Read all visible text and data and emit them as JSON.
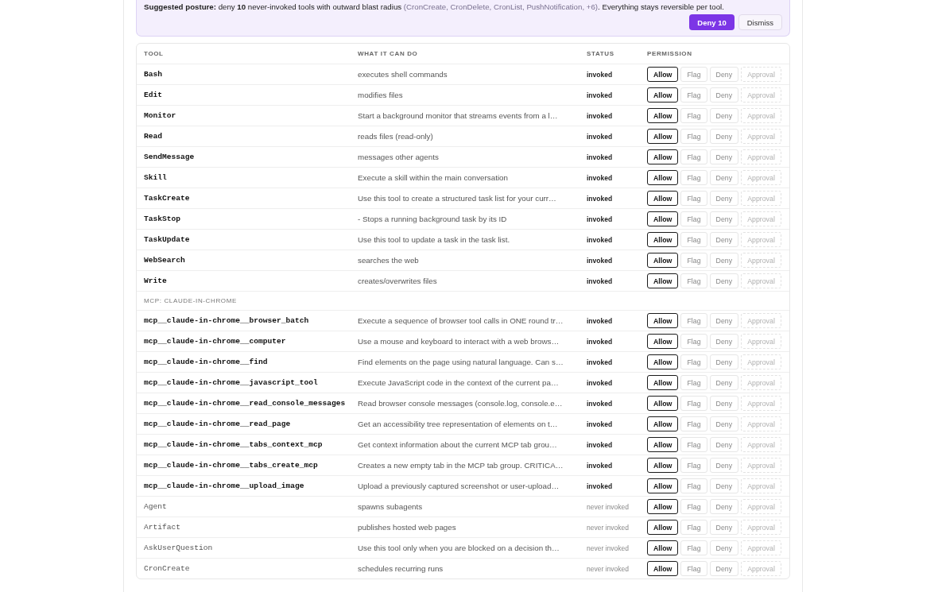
{
  "suggestion": {
    "text": "**Suggested posture:** deny **10** never-invoked tools with outward blast radius",
    "examples": "(CronCreate, CronDelete, CronList, PushNotification, +6)",
    "tail": ". Everything stays reversible per tool.",
    "buttons": [
      {
        "label": "Deny 10",
        "kind": "deny"
      },
      {
        "label": "Dismiss",
        "kind": "dismiss"
      }
    ]
  },
  "table": {
    "columns": [
      "TOOL",
      "WHAT IT CAN DO",
      "STATUS",
      "PERMISSION"
    ],
    "rows": [
      {
        "kind": "tool",
        "tool": "Bash",
        "description": "executes shell commands",
        "status": "invoked",
        "invoked": true,
        "permission": [
          {
            "label": "Allow",
            "selected": true,
            "disabled": false
          },
          {
            "label": "Flag",
            "selected": false,
            "disabled": false
          },
          {
            "label": "Deny",
            "selected": false,
            "disabled": false
          },
          {
            "label": "Approval",
            "selected": false,
            "disabled": true
          }
        ]
      },
      {
        "kind": "tool",
        "tool": "Edit",
        "description": "modifies files",
        "status": "invoked",
        "invoked": true,
        "permission": [
          {
            "label": "Allow",
            "selected": true,
            "disabled": false
          },
          {
            "label": "Flag",
            "selected": false,
            "disabled": false
          },
          {
            "label": "Deny",
            "selected": false,
            "disabled": false
          },
          {
            "label": "Approval",
            "selected": false,
            "disabled": true
          }
        ]
      },
      {
        "kind": "tool",
        "tool": "Monitor",
        "description": "Start a background monitor that streams events from a l…",
        "status": "invoked",
        "invoked": true,
        "permission": [
          {
            "label": "Allow",
            "selected": true,
            "disabled": false
          },
          {
            "label": "Flag",
            "selected": false,
            "disabled": false
          },
          {
            "label": "Deny",
            "selected": false,
            "disabled": false
          },
          {
            "label": "Approval",
            "selected": false,
            "disabled": true
          }
        ]
      },
      {
        "kind": "tool",
        "tool": "Read",
        "description": "reads files (read-only)",
        "status": "invoked",
        "invoked": true,
        "permission": [
          {
            "label": "Allow",
            "selected": true,
            "disabled": false
          },
          {
            "label": "Flag",
            "selected": false,
            "disabled": false
          },
          {
            "label": "Deny",
            "selected": false,
            "disabled": false
          },
          {
            "label": "Approval",
            "selected": false,
            "disabled": true
          }
        ]
      },
      {
        "kind": "tool",
        "tool": "SendMessage",
        "description": "messages other agents",
        "status": "invoked",
        "invoked": true,
        "permission": [
          {
            "label": "Allow",
            "selected": true,
            "disabled": false
          },
          {
            "label": "Flag",
            "selected": false,
            "disabled": false
          },
          {
            "label": "Deny",
            "selected": false,
            "disabled": false
          },
          {
            "label": "Approval",
            "selected": false,
            "disabled": true
          }
        ]
      },
      {
        "kind": "tool",
        "tool": "Skill",
        "description": "Execute a skill within the main conversation",
        "status": "invoked",
        "invoked": true,
        "permission": [
          {
            "label": "Allow",
            "selected": true,
            "disabled": false
          },
          {
            "label": "Flag",
            "selected": false,
            "disabled": false
          },
          {
            "label": "Deny",
            "selected": false,
            "disabled": false
          },
          {
            "label": "Approval",
            "selected": false,
            "disabled": true
          }
        ]
      },
      {
        "kind": "tool",
        "tool": "TaskCreate",
        "description": "Use this tool to create a structured task list for your curr…",
        "status": "invoked",
        "invoked": true,
        "permission": [
          {
            "label": "Allow",
            "selected": true,
            "disabled": false
          },
          {
            "label": "Flag",
            "selected": false,
            "disabled": false
          },
          {
            "label": "Deny",
            "selected": false,
            "disabled": false
          },
          {
            "label": "Approval",
            "selected": false,
            "disabled": true
          }
        ]
      },
      {
        "kind": "tool",
        "tool": "TaskStop",
        "description": "- Stops a running background task by its ID",
        "status": "invoked",
        "invoked": true,
        "permission": [
          {
            "label": "Allow",
            "selected": true,
            "disabled": false
          },
          {
            "label": "Flag",
            "selected": false,
            "disabled": false
          },
          {
            "label": "Deny",
            "selected": false,
            "disabled": false
          },
          {
            "label": "Approval",
            "selected": false,
            "disabled": true
          }
        ]
      },
      {
        "kind": "tool",
        "tool": "TaskUpdate",
        "description": "Use this tool to update a task in the task list.",
        "status": "invoked",
        "invoked": true,
        "permission": [
          {
            "label": "Allow",
            "selected": true,
            "disabled": false
          },
          {
            "label": "Flag",
            "selected": false,
            "disabled": false
          },
          {
            "label": "Deny",
            "selected": false,
            "disabled": false
          },
          {
            "label": "Approval",
            "selected": false,
            "disabled": true
          }
        ]
      },
      {
        "kind": "tool",
        "tool": "WebSearch",
        "description": "searches the web",
        "status": "invoked",
        "invoked": true,
        "permission": [
          {
            "label": "Allow",
            "selected": true,
            "disabled": false
          },
          {
            "label": "Flag",
            "selected": false,
            "disabled": false
          },
          {
            "label": "Deny",
            "selected": false,
            "disabled": false
          },
          {
            "label": "Approval",
            "selected": false,
            "disabled": true
          }
        ]
      },
      {
        "kind": "tool",
        "tool": "Write",
        "description": "creates/overwrites files",
        "status": "invoked",
        "invoked": true,
        "permission": [
          {
            "label": "Allow",
            "selected": true,
            "disabled": false
          },
          {
            "label": "Flag",
            "selected": false,
            "disabled": false
          },
          {
            "label": "Deny",
            "selected": false,
            "disabled": false
          },
          {
            "label": "Approval",
            "selected": false,
            "disabled": true
          }
        ]
      },
      {
        "kind": "section",
        "label": "MCP: CLAUDE-IN-CHROME"
      },
      {
        "kind": "tool",
        "tool": "mcp__claude-in-chrome__browser_batch",
        "description": "Execute a sequence of browser tool calls in ONE round tr…",
        "status": "invoked",
        "invoked": true,
        "permission": [
          {
            "label": "Allow",
            "selected": true,
            "disabled": false
          },
          {
            "label": "Flag",
            "selected": false,
            "disabled": false
          },
          {
            "label": "Deny",
            "selected": false,
            "disabled": false
          },
          {
            "label": "Approval",
            "selected": false,
            "disabled": true
          }
        ]
      },
      {
        "kind": "tool",
        "tool": "mcp__claude-in-chrome__computer",
        "description": "Use a mouse and keyboard to interact with a web brows…",
        "status": "invoked",
        "invoked": true,
        "permission": [
          {
            "label": "Allow",
            "selected": true,
            "disabled": false
          },
          {
            "label": "Flag",
            "selected": false,
            "disabled": false
          },
          {
            "label": "Deny",
            "selected": false,
            "disabled": false
          },
          {
            "label": "Approval",
            "selected": false,
            "disabled": true
          }
        ]
      },
      {
        "kind": "tool",
        "tool": "mcp__claude-in-chrome__find",
        "description": "Find elements on the page using natural language. Can s…",
        "status": "invoked",
        "invoked": true,
        "permission": [
          {
            "label": "Allow",
            "selected": true,
            "disabled": false
          },
          {
            "label": "Flag",
            "selected": false,
            "disabled": false
          },
          {
            "label": "Deny",
            "selected": false,
            "disabled": false
          },
          {
            "label": "Approval",
            "selected": false,
            "disabled": true
          }
        ]
      },
      {
        "kind": "tool",
        "tool": "mcp__claude-in-chrome__javascript_tool",
        "description": "Execute JavaScript code in the context of the current pa…",
        "status": "invoked",
        "invoked": true,
        "permission": [
          {
            "label": "Allow",
            "selected": true,
            "disabled": false
          },
          {
            "label": "Flag",
            "selected": false,
            "disabled": false
          },
          {
            "label": "Deny",
            "selected": false,
            "disabled": false
          },
          {
            "label": "Approval",
            "selected": false,
            "disabled": true
          }
        ]
      },
      {
        "kind": "tool",
        "tool": "mcp__claude-in-chrome__read_console_messages",
        "description": "Read browser console messages (console.log, console.e…",
        "status": "invoked",
        "invoked": true,
        "permission": [
          {
            "label": "Allow",
            "selected": true,
            "disabled": false
          },
          {
            "label": "Flag",
            "selected": false,
            "disabled": false
          },
          {
            "label": "Deny",
            "selected": false,
            "disabled": false
          },
          {
            "label": "Approval",
            "selected": false,
            "disabled": true
          }
        ]
      },
      {
        "kind": "tool",
        "tool": "mcp__claude-in-chrome__read_page",
        "description": "Get an accessibility tree representation of elements on t…",
        "status": "invoked",
        "invoked": true,
        "permission": [
          {
            "label": "Allow",
            "selected": true,
            "disabled": false
          },
          {
            "label": "Flag",
            "selected": false,
            "disabled": false
          },
          {
            "label": "Deny",
            "selected": false,
            "disabled": false
          },
          {
            "label": "Approval",
            "selected": false,
            "disabled": true
          }
        ]
      },
      {
        "kind": "tool",
        "tool": "mcp__claude-in-chrome__tabs_context_mcp",
        "description": "Get context information about the current MCP tab grou…",
        "status": "invoked",
        "invoked": true,
        "permission": [
          {
            "label": "Allow",
            "selected": true,
            "disabled": false
          },
          {
            "label": "Flag",
            "selected": false,
            "disabled": false
          },
          {
            "label": "Deny",
            "selected": false,
            "disabled": false
          },
          {
            "label": "Approval",
            "selected": false,
            "disabled": true
          }
        ]
      },
      {
        "kind": "tool",
        "tool": "mcp__claude-in-chrome__tabs_create_mcp",
        "description": "Creates a new empty tab in the MCP tab group. CRITICA…",
        "status": "invoked",
        "invoked": true,
        "permission": [
          {
            "label": "Allow",
            "selected": true,
            "disabled": false
          },
          {
            "label": "Flag",
            "selected": false,
            "disabled": false
          },
          {
            "label": "Deny",
            "selected": false,
            "disabled": false
          },
          {
            "label": "Approval",
            "selected": false,
            "disabled": true
          }
        ]
      },
      {
        "kind": "tool",
        "tool": "mcp__claude-in-chrome__upload_image",
        "description": "Upload a previously captured screenshot or user-upload…",
        "status": "invoked",
        "invoked": true,
        "permission": [
          {
            "label": "Allow",
            "selected": true,
            "disabled": false
          },
          {
            "label": "Flag",
            "selected": false,
            "disabled": false
          },
          {
            "label": "Deny",
            "selected": false,
            "disabled": false
          },
          {
            "label": "Approval",
            "selected": false,
            "disabled": true
          }
        ]
      },
      {
        "kind": "tool",
        "tool": "Agent",
        "description": "spawns subagents",
        "status": "never invoked",
        "invoked": false,
        "permission": [
          {
            "label": "Allow",
            "selected": true,
            "disabled": false
          },
          {
            "label": "Flag",
            "selected": false,
            "disabled": false
          },
          {
            "label": "Deny",
            "selected": false,
            "disabled": false
          },
          {
            "label": "Approval",
            "selected": false,
            "disabled": true
          }
        ]
      },
      {
        "kind": "tool",
        "tool": "Artifact",
        "description": "publishes hosted web pages",
        "status": "never invoked",
        "invoked": false,
        "permission": [
          {
            "label": "Allow",
            "selected": true,
            "disabled": false
          },
          {
            "label": "Flag",
            "selected": false,
            "disabled": false
          },
          {
            "label": "Deny",
            "selected": false,
            "disabled": false
          },
          {
            "label": "Approval",
            "selected": false,
            "disabled": true
          }
        ]
      },
      {
        "kind": "tool",
        "tool": "AskUserQuestion",
        "description": "Use this tool only when you are blocked on a decision th…",
        "status": "never invoked",
        "invoked": false,
        "permission": [
          {
            "label": "Allow",
            "selected": true,
            "disabled": false
          },
          {
            "label": "Flag",
            "selected": false,
            "disabled": false
          },
          {
            "label": "Deny",
            "selected": false,
            "disabled": false
          },
          {
            "label": "Approval",
            "selected": false,
            "disabled": true
          }
        ]
      },
      {
        "kind": "tool",
        "tool": "CronCreate",
        "description": "schedules recurring runs",
        "status": "never invoked",
        "invoked": false,
        "permission": [
          {
            "label": "Allow",
            "selected": true,
            "disabled": false
          },
          {
            "label": "Flag",
            "selected": false,
            "disabled": false
          },
          {
            "label": "Deny",
            "selected": false,
            "disabled": false
          },
          {
            "label": "Approval",
            "selected": false,
            "disabled": true
          }
        ]
      }
    ]
  }
}
